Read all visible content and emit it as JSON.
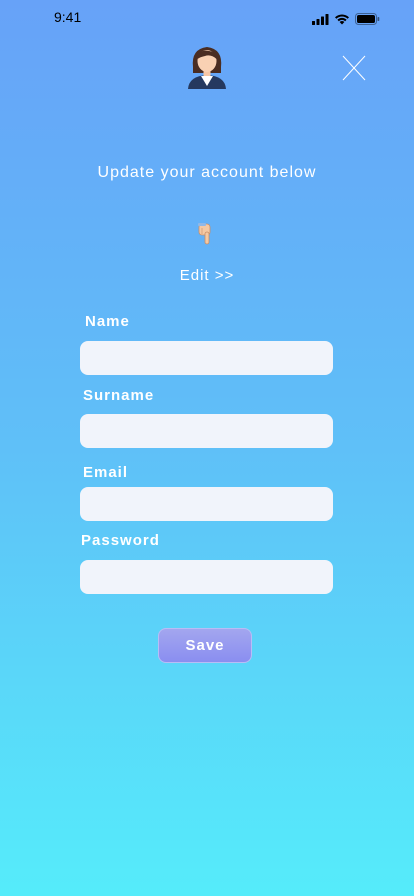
{
  "status_bar": {
    "time": "9:41"
  },
  "header": {
    "avatar_icon": "woman-avatar-icon",
    "close_icon": "close-icon"
  },
  "content": {
    "headline": "Update your account below",
    "hand_icon": "pointing-down-hand-icon",
    "edit_link": "Edit >>"
  },
  "form": {
    "name_label": "Name",
    "name_value": "",
    "surname_label": "Surname",
    "surname_value": "",
    "email_label": "Email",
    "email_value": "",
    "password_label": "Password",
    "password_value": "",
    "save_label": "Save"
  },
  "colors": {
    "gradient_top": "#67a2f8",
    "gradient_bottom": "#55ecfa",
    "input_background": "#f1f4fb",
    "button_top": "#a3a6ef",
    "button_bottom": "#8a8ef0"
  }
}
